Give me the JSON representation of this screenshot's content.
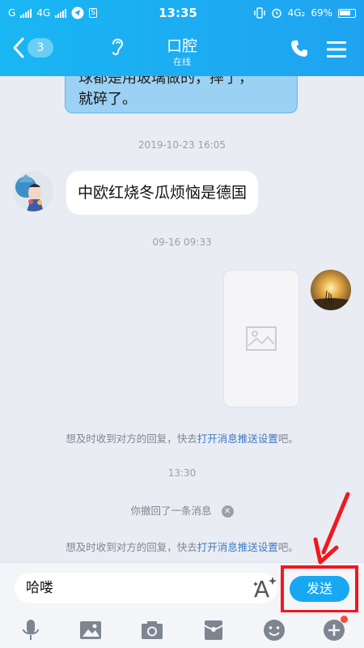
{
  "status_bar": {
    "carrier1": "G",
    "carrier2": "4G",
    "time": "13:35",
    "network": "4G₂",
    "battery": "69%"
  },
  "header": {
    "back_count": "3",
    "title": "口腔",
    "subtitle": "在线"
  },
  "messages": {
    "top_bubble_line1": "球都是用玻璃做的，摔了，",
    "top_bubble_line2": "就碎了。",
    "timestamp1": "2019-10-23 16:05",
    "incoming_text": "中欧红烧冬瓜烦恼是德国",
    "timestamp2": "09-16 09:33",
    "notice1_prefix": "想及时收到对方的回复，快去",
    "notice1_link": "打开消息推送设置",
    "notice1_suffix": "吧。",
    "timestamp3": "13:30",
    "recall_text": "你撤回了一条消息",
    "recall_close": "✕",
    "notice2_prefix": "想及时收到对方的回复，快去",
    "notice2_link": "打开消息推送设置",
    "notice2_suffix": "吧。"
  },
  "input_bar": {
    "input_value": "哈喽",
    "send_label": "发送"
  },
  "colors": {
    "header": "#1fa3f0",
    "send_button": "#16a8f2",
    "highlight": "#f1171e",
    "link": "#3f78c4"
  },
  "icons": [
    "back-chevron-icon",
    "ear-icon",
    "phone-icon",
    "menu-icon",
    "font-style-icon",
    "microphone-icon",
    "image-icon",
    "camera-icon",
    "red-packet-icon",
    "emoji-icon",
    "plus-icon"
  ]
}
